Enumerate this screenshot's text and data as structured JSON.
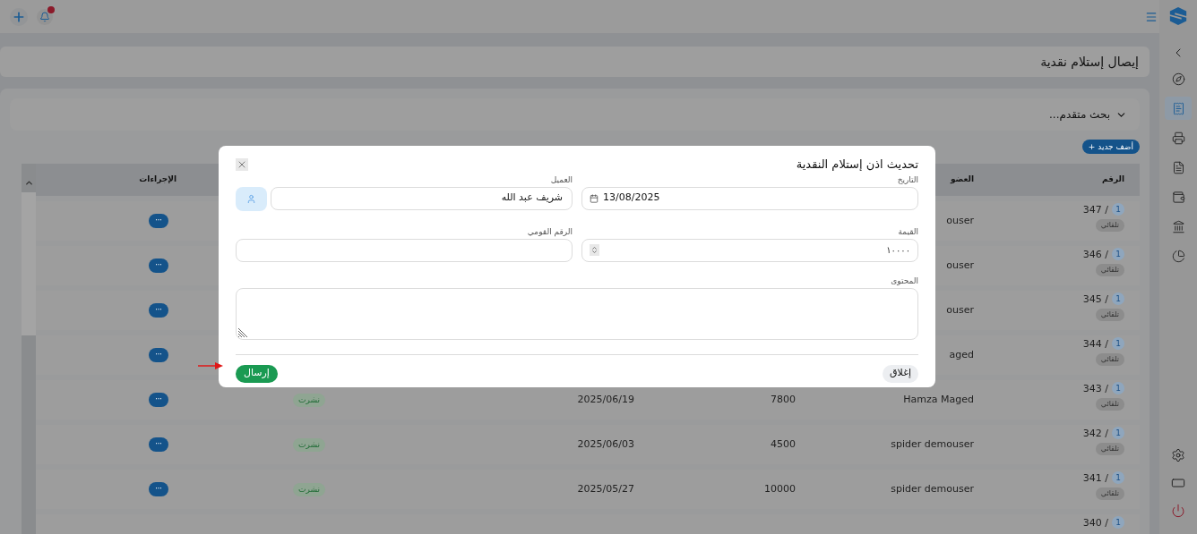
{
  "sidebar": {
    "items": [
      {
        "selected": false
      },
      {
        "selected": true
      },
      {
        "selected": false
      },
      {
        "selected": false
      },
      {
        "selected": false
      },
      {
        "selected": false
      },
      {
        "selected": false
      }
    ]
  },
  "page_title": "إيصال إستلام نقدية",
  "search": {
    "label": "بحث متقدم...",
    "expanded": false
  },
  "add_button": "أضف جديد +",
  "table": {
    "columns": {
      "number": "الرقم",
      "member": "العضو",
      "actions": "الإجراءات"
    },
    "rows": [
      {
        "number": "347 /",
        "count": "1",
        "source": "تلقائي",
        "member": "ouser",
        "action": "···"
      },
      {
        "number": "346 /",
        "count": "1",
        "source": "تلقائي",
        "member": "ouser",
        "action": "···"
      },
      {
        "number": "345 /",
        "count": "1",
        "source": "تلقائي",
        "member": "ouser",
        "action": "···"
      },
      {
        "number": "344 /",
        "count": "1",
        "source": "تلقائي",
        "member": "aged",
        "action": "···"
      },
      {
        "number": "343 /",
        "count": "1",
        "source": "تلقائي",
        "member": "Hamza Maged",
        "value": "7800",
        "date": "2025/06/19",
        "status": "نشرت",
        "action": "···"
      },
      {
        "number": "342 /",
        "count": "1",
        "source": "تلقائي",
        "member": "spider demouser",
        "value": "4500",
        "date": "2025/06/03",
        "status": "نشرت",
        "action": "···"
      },
      {
        "number": "341 /",
        "count": "1",
        "source": "تلقائي",
        "member": "spider demouser",
        "value": "10000",
        "date": "2025/05/27",
        "status": "نشرت",
        "action": "···"
      },
      {
        "number": "340 /",
        "count": "1"
      }
    ]
  },
  "modal": {
    "title": "تحديث اذن إستلام النقدية",
    "date": {
      "label": "التاريخ",
      "value": "13/08/2025"
    },
    "customer": {
      "label": "العميل",
      "value": "شريف عبد الله"
    },
    "amount": {
      "label": "القيمة",
      "value": "١٠٠٠٠"
    },
    "national_id": {
      "label": "الرقم القومي"
    },
    "content": {
      "label": "المحتوى"
    },
    "close_button": "إغلاق",
    "submit_button": "إرسال"
  }
}
